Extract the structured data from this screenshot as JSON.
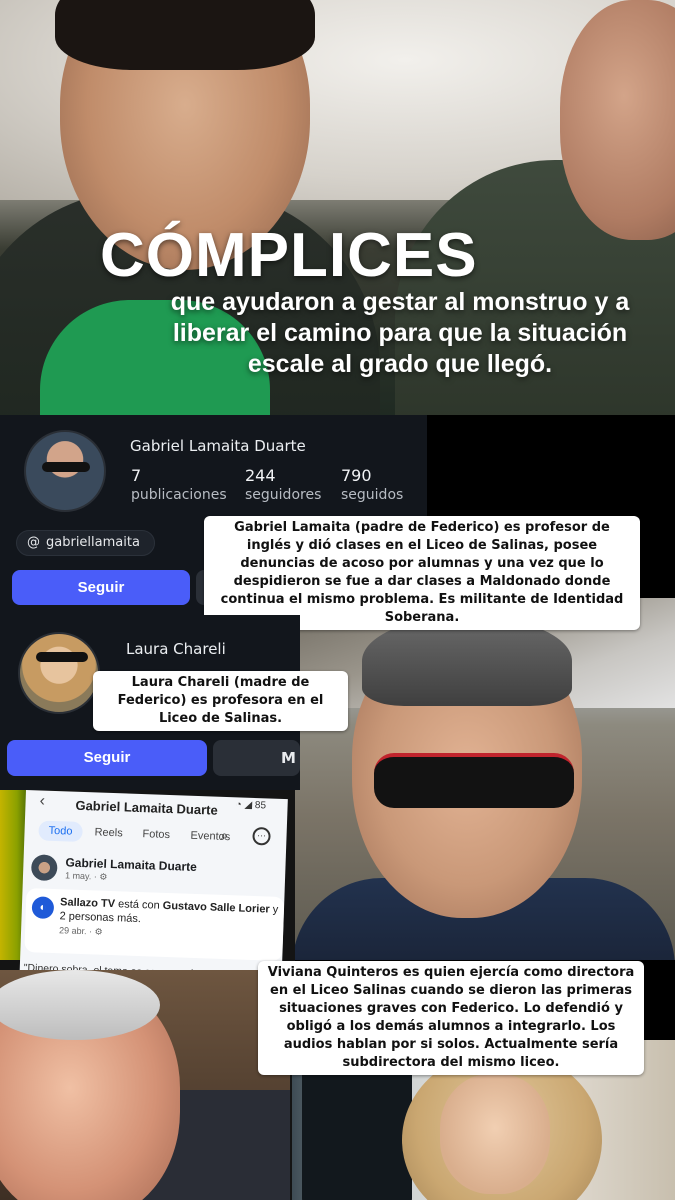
{
  "hero": {
    "title": "CÓMPLICES",
    "subtitle": "que ayudaron a gestar al monstruo y a liberar el camino para que la situación escale al grado que llegó."
  },
  "profile1": {
    "name": "Gabriel Lamaita Duarte",
    "stats": [
      {
        "value": "7",
        "label": "publicaciones"
      },
      {
        "value": "244",
        "label": "seguidores"
      },
      {
        "value": "790",
        "label": "seguidos"
      }
    ],
    "threads_handle": "gabriellamaita",
    "follow_label": "Seguir"
  },
  "profile2": {
    "name": "Laura Chareli",
    "follow_label": "Seguir",
    "message_label": "M"
  },
  "captions": {
    "gabriel": "Gabriel Lamaita (padre de Federico) es profesor de inglés y dió clases en el Liceo de Salinas, posee denuncias de acoso por alumnas y una vez que lo despidieron se fue a dar clases a Maldonado donde continua el mismo problema. Es militante de Identidad Soberana.",
    "laura": "Laura Chareli (madre de Federico) es profesora en el Liceo de Salinas.",
    "viviana": "Viviana Quinteros es quien ejercía como directora en el Liceo Salinas cuando se dieron las primeras situaciones graves con Federico. Lo defendió y obligó a los demás alumnos a integrarlo. Los audios hablan por si solos. Actualmente sería subdirectora del mismo liceo."
  },
  "phone": {
    "back_icon": "‹",
    "title": "Gabriel Lamaita Duarte",
    "status": "◔ ◢ 85",
    "tabs": [
      "Todo",
      "Reels",
      "Fotos",
      "Eventos"
    ],
    "post1": {
      "name": "Gabriel Lamaita Duarte",
      "date": "1 may. · ⚙"
    },
    "post2": {
      "text_prefix": "Sallazo TV",
      "text_mid": " está con ",
      "text_bold": "Gustavo Salle Lorier",
      "text_suffix": " y 2 personas más.",
      "date": "29 abr. · ⚙"
    },
    "quote": "\"Dinero sobra, el tema es como se d... más"
  },
  "colors": {
    "card_bg": "#12161c",
    "follow_btn": "#4a5df9",
    "dark_btn": "#2a2f37"
  }
}
